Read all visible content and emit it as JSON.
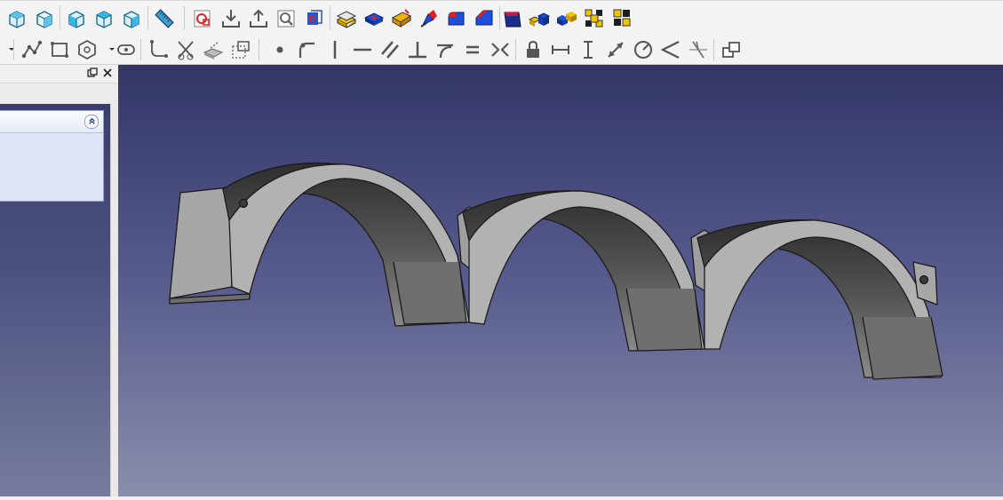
{
  "window": {
    "title": ""
  },
  "toolbar_view": {
    "buttons": [
      {
        "icon": "view-axonometric-icon"
      },
      {
        "icon": "view-fit-selection-icon"
      },
      {
        "icon": "view-front-icon"
      },
      {
        "icon": "view-top-icon"
      },
      {
        "icon": "view-right-icon"
      },
      {
        "icon": "measure-distance-icon"
      }
    ]
  },
  "toolbar_part": {
    "buttons": [
      {
        "icon": "create-sketch-icon"
      },
      {
        "icon": "import-icon"
      },
      {
        "icon": "export-icon"
      },
      {
        "icon": "view-sketch-icon"
      },
      {
        "icon": "map-sketch-icon"
      },
      {
        "icon": "pad-icon"
      },
      {
        "icon": "pocket-icon"
      },
      {
        "icon": "revolution-icon"
      },
      {
        "icon": "groove-icon"
      },
      {
        "icon": "fillet-icon"
      },
      {
        "icon": "chamfer-icon"
      },
      {
        "icon": "draft-icon"
      },
      {
        "icon": "mirrored-icon"
      },
      {
        "icon": "linear-pattern-icon"
      },
      {
        "icon": "polar-pattern-icon"
      },
      {
        "icon": "multitransform-icon"
      }
    ]
  },
  "toolbar_sketch": {
    "buttons": [
      {
        "icon": "dropdown-arrow-icon"
      },
      {
        "icon": "polyline-icon"
      },
      {
        "icon": "rectangle-icon"
      },
      {
        "icon": "polygon-icon"
      },
      {
        "icon": "slot-icon"
      },
      {
        "icon": "fillet-sketch-icon"
      },
      {
        "icon": "trim-icon"
      },
      {
        "icon": "external-geometry-icon"
      },
      {
        "icon": "construction-mode-icon"
      },
      {
        "icon": "constrain-coincident-icon"
      },
      {
        "icon": "constrain-point-on-object-icon"
      },
      {
        "icon": "constrain-vertical-icon"
      },
      {
        "icon": "constrain-horizontal-icon"
      },
      {
        "icon": "constrain-parallel-icon"
      },
      {
        "icon": "constrain-perpendicular-icon"
      },
      {
        "icon": "constrain-tangent-icon"
      },
      {
        "icon": "constrain-equal-icon"
      },
      {
        "icon": "constrain-symmetric-icon"
      },
      {
        "icon": "constrain-lock-icon"
      },
      {
        "icon": "constrain-horizontal-distance-icon"
      },
      {
        "icon": "constrain-vertical-distance-icon"
      },
      {
        "icon": "constrain-distance-icon"
      },
      {
        "icon": "constrain-radius-icon"
      },
      {
        "icon": "constrain-angle-icon"
      },
      {
        "icon": "constrain-snell-icon"
      },
      {
        "icon": "toggle-driving-icon"
      }
    ]
  },
  "combo_view": {
    "dock_buttons": [
      {
        "icon": "float-icon"
      },
      {
        "icon": "close-icon"
      }
    ]
  },
  "colors": {
    "viewport_top": "#333665",
    "viewport_bottom": "#8a8eac",
    "part_face": "#a9a9a9",
    "part_shadow": "#4a4a4a"
  }
}
